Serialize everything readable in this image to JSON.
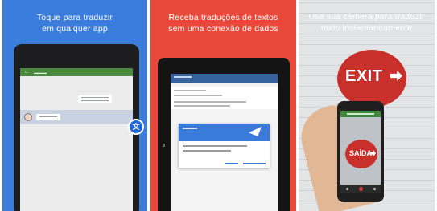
{
  "panels": [
    {
      "caption_line1": "Toque para traduzir",
      "caption_line2": "em qualquer app",
      "background": "#3b7ddd"
    },
    {
      "caption_line1": "Receba traduções de textos",
      "caption_line2": "sem uma conexão de dados",
      "background": "#e8493a"
    },
    {
      "caption_line1": "Use sua câmera para traduzir",
      "caption_line2": "texto instantaneamente",
      "background": "#d9dadc"
    }
  ],
  "signs": {
    "original": "EXIT",
    "translated": "SAÍDA"
  },
  "icons": {
    "translate_badge": "translate-icon",
    "back": "arrow-back-icon",
    "airplane": "airplane-icon",
    "exit_arrow": "arrow-right-icon",
    "shutter": "camera-shutter-icon"
  },
  "colors": {
    "accent_green": "#4a8a3e",
    "accent_blue": "#1e65d6",
    "sign_red": "#c9302c"
  }
}
